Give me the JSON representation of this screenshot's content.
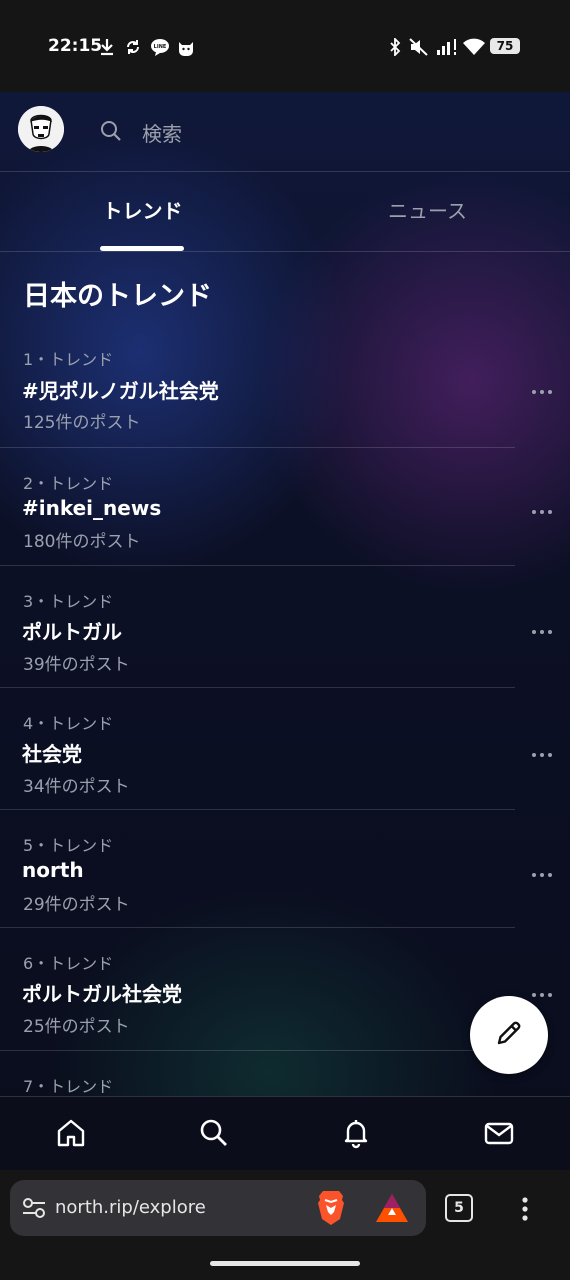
{
  "status_bar": {
    "time": "22:15",
    "battery": "75",
    "icons": [
      "download-icon",
      "sync-icon",
      "line-app-icon",
      "cat-app-icon",
      "bluetooth-icon",
      "mute-icon",
      "signal-icon",
      "wifi-icon"
    ]
  },
  "header": {
    "search_placeholder": "検索",
    "icons": [
      "avatar",
      "search-icon"
    ]
  },
  "tabs": [
    {
      "label": "トレンド",
      "active": true
    },
    {
      "label": "ニュース",
      "active": false
    }
  ],
  "section_title": "日本のトレンド",
  "trends": [
    {
      "meta": "1・トレンド",
      "name": "#児ポルノガル社会党",
      "count": "125件のポスト"
    },
    {
      "meta": "2・トレンド",
      "name": "#inkei_news",
      "count": "180件のポスト"
    },
    {
      "meta": "3・トレンド",
      "name": "ポルトガル",
      "count": "39件のポスト"
    },
    {
      "meta": "4・トレンド",
      "name": "社会党",
      "count": "34件のポスト"
    },
    {
      "meta": "5・トレンド",
      "name": "north",
      "count": "29件のポスト"
    },
    {
      "meta": "6・トレンド",
      "name": "ポルトガル社会党",
      "count": "25件のポスト"
    },
    {
      "meta": "7・トレンド",
      "name": "",
      "count": ""
    }
  ],
  "bottom_nav": [
    "home-icon",
    "search-icon",
    "bell-icon",
    "mail-icon"
  ],
  "browser": {
    "url": "north.rip/explore",
    "tab_count": "5",
    "icons": [
      "site-settings-icon",
      "brave-shield-icon",
      "bat-rewards-icon",
      "menu-icon"
    ]
  },
  "colors": {
    "muted_text": "#9aa0ad",
    "fab_bg": "#ffffff"
  }
}
